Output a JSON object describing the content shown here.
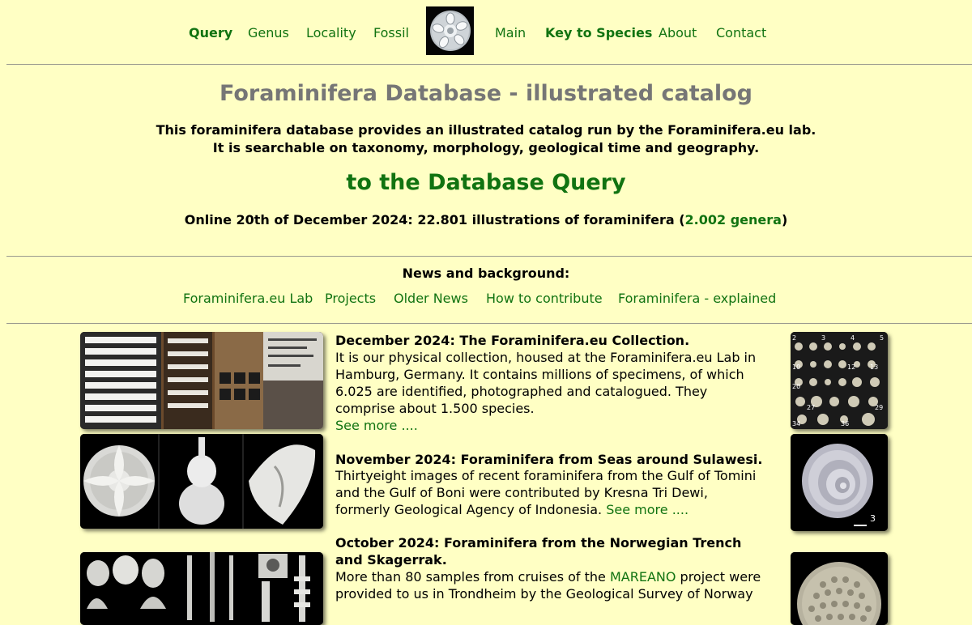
{
  "nav": {
    "left": [
      "Query",
      "Genus",
      "Locality",
      "Fossil"
    ],
    "right": [
      "Main",
      "Key to Species",
      "About",
      "Contact"
    ]
  },
  "header": {
    "title": "Foraminifera Database - illustrated catalog",
    "intro_line1": "This foraminifera database provides an illustrated catalog run by the Foraminifera.eu lab.",
    "intro_line2": "It is searchable on taxonomy, morphology, geological time and geography.",
    "query_link": "to the Database Query",
    "online_text": "Online 20th of December 2024: 22.801 illustrations of foraminifera (",
    "genera_link": "2.002 genera",
    "online_close": ")"
  },
  "news": {
    "heading": "News and background:",
    "links": [
      "Foraminifera.eu Lab",
      "Projects",
      "Older News",
      "How to contribute",
      "Foraminifera - explained"
    ]
  },
  "entries": [
    {
      "title": "December 2024: The Foraminifera.eu Collection.",
      "body": "It is our physical collection, housed at the Foraminifera.eu Lab in Hamburg, Germany. It contains millions of specimens, of which 6.025 are identified, photographed and catalogued. They comprise about 1.500 species.",
      "more": "See more ...."
    },
    {
      "title": "November 2024: Foraminifera from Seas around Sulawesi.",
      "body": "Thirtyeight images of recent foraminifera from the Gulf of Tomini and the Gulf of Boni were contributed by Kresna Tri Dewi, formerly Geological Agency of Indonesia.",
      "more": "See more ...."
    },
    {
      "title": "October 2024: Foraminifera from the Norwegian Trench and Skagerrak.",
      "body_pre": "More than 80 samples from cruises of the ",
      "mareano": "MAREANO",
      "body_post": " project were provided to us in Trondheim by the Geological Survey of Norway"
    }
  ],
  "thumb_labels": {
    "grid_numbers": [
      "2",
      "3",
      "4",
      "5",
      "10",
      "12",
      "13",
      "20",
      "27",
      "29",
      "34",
      "36"
    ],
    "sulawesi_right": "3"
  },
  "colors": {
    "background": "#ffffc4",
    "link": "#117311",
    "title_gray": "#767676"
  }
}
